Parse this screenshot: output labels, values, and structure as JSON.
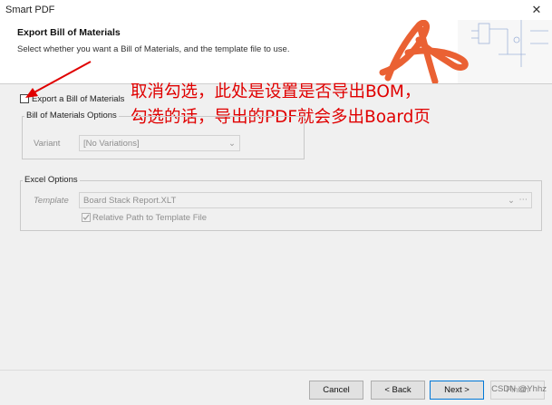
{
  "window": {
    "title": "Smart PDF"
  },
  "header": {
    "title": "Export Bill of Materials",
    "subtitle": "Select whether you want a Bill of Materials, and the template file to use."
  },
  "export_bom": {
    "label": "Export a Bill of Materials",
    "checked": false
  },
  "bom_options": {
    "group_title": "Bill of Materials Options",
    "variant_label": "Variant",
    "variant_value": "[No Variations]"
  },
  "excel_options": {
    "group_title": "Excel Options",
    "template_label": "Template",
    "template_value": "Board Stack Report.XLT",
    "relative_path_label": "Relative Path to Template File",
    "relative_path_checked": true
  },
  "annotation": {
    "line1": "取消勾选，此处是设置是否导出BOM，",
    "line2": "勾选的话，导出的PDF就会多出Board页",
    "color": "#e00000"
  },
  "buttons": {
    "cancel": "Cancel",
    "back": "< Back",
    "next": "Next >",
    "finish": "Finish"
  },
  "watermark": "CSDN @Yhhz"
}
